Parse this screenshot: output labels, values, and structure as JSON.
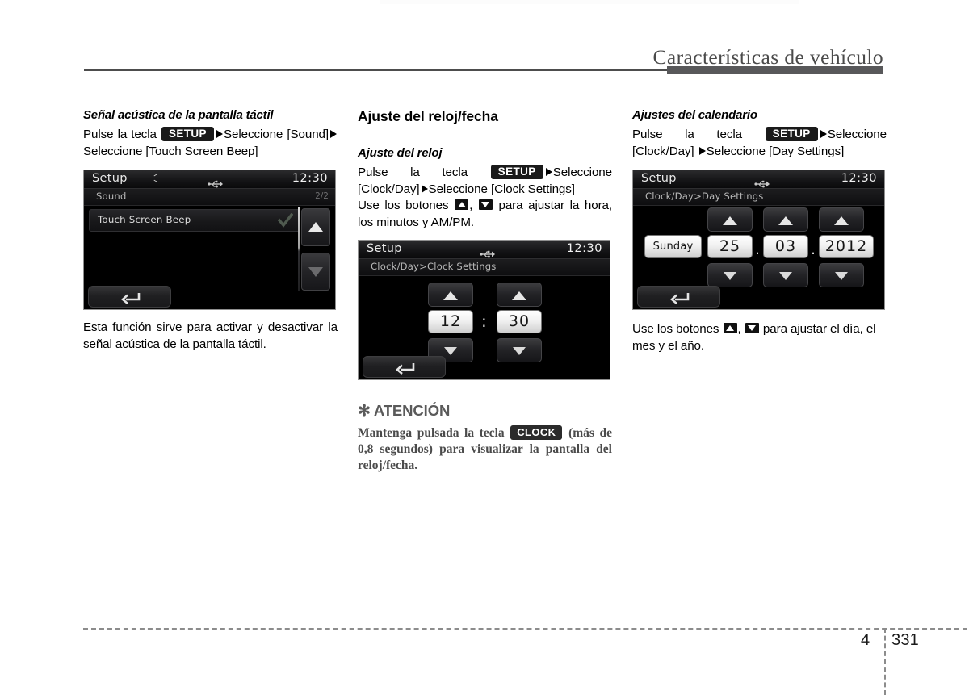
{
  "header": {
    "title": "Características de vehículo"
  },
  "footer": {
    "chapter": "4",
    "page": "331"
  },
  "col1": {
    "subtitle": "Señal acústica de la pantalla táctil",
    "instr_a": "Pulse la tecla",
    "keytag": "SETUP",
    "instr_b": "Seleccione [Sound]",
    "instr_c": "Seleccione [Touch Screen Beep]",
    "screen": {
      "title": "Setup",
      "clock": "12:30",
      "breadcrumb": "Sound",
      "page_indicator": "2/2",
      "row_label": "Touch Screen Beep",
      "bt_icon": "bluetooth-icon",
      "usb_icon": "usb-icon",
      "check_icon": "checkmark-icon",
      "back_icon": "back-arrow-icon",
      "scroll_up_icon": "scroll-up-icon",
      "scroll_down_icon": "scroll-down-icon"
    },
    "caption": "Esta función sirve para activar y desactivar la señal acústica de la pantalla táctil."
  },
  "col2": {
    "title": "Ajuste del reloj/fecha",
    "subtitle": "Ajuste del reloj",
    "instr_a": "Pulse la tecla",
    "keytag": "SETUP",
    "instr_b": "Seleccione [Clock/Day]",
    "instr_c": "Seleccione [Clock Settings]",
    "buttons_a": "Use los botones",
    "buttons_b": "para ajustar la hora, los minutos y AM/PM.",
    "screen": {
      "title": "Setup",
      "clock": "12:30",
      "breadcrumb": "Clock/Day>Clock Settings",
      "hour": "12",
      "separator": ":",
      "minute": "30",
      "usb_icon": "usb-icon",
      "back_icon": "back-arrow-icon"
    },
    "attention": {
      "asterisk": "✻",
      "title": "ATENCIÓN",
      "text_a": "Mantenga pulsada la tecla",
      "keytag": "CLOCK",
      "text_b": "(más de 0,8 segundos) para visualizar la pantalla del reloj/fecha."
    }
  },
  "col3": {
    "subtitle": "Ajustes del calendario",
    "instr_a": "Pulse la tecla",
    "keytag": "SETUP",
    "instr_b": "Seleccione [Clock/Day]",
    "instr_c": "Seleccione [Day Settings]",
    "screen": {
      "title": "Setup",
      "clock": "12:30",
      "breadcrumb": "Clock/Day>Day Settings",
      "weekday": "Sunday",
      "day": "25",
      "sep1": ".",
      "month": "03",
      "sep2": ".",
      "year": "2012",
      "usb_icon": "usb-icon",
      "back_icon": "back-arrow-icon"
    },
    "caption_a": "Use los botones",
    "caption_b": "para ajustar el día, el mes y el año."
  }
}
